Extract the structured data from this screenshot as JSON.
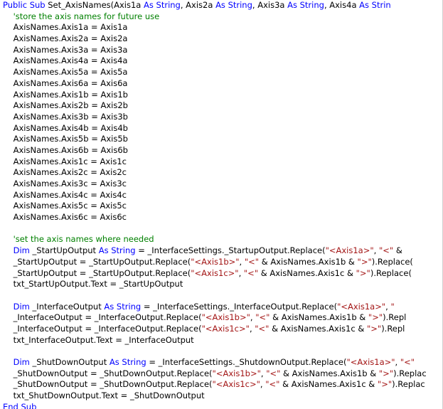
{
  "editor": {
    "colors": {
      "keyword": "#0000ff",
      "comment": "#008000",
      "string": "#a31515",
      "text": "#000000",
      "background": "#ffffff"
    },
    "lines": [
      {
        "indent": "",
        "tokens": [
          {
            "t": "kw",
            "v": "Public Sub"
          },
          {
            "t": "tx",
            "v": " Set_AxisNames(Axis1a "
          },
          {
            "t": "kw",
            "v": "As"
          },
          {
            "t": "tx",
            "v": " "
          },
          {
            "t": "kw",
            "v": "String"
          },
          {
            "t": "tx",
            "v": ", Axis2a "
          },
          {
            "t": "kw",
            "v": "As"
          },
          {
            "t": "tx",
            "v": " "
          },
          {
            "t": "kw",
            "v": "String"
          },
          {
            "t": "tx",
            "v": ", Axis3a "
          },
          {
            "t": "kw",
            "v": "As"
          },
          {
            "t": "tx",
            "v": " "
          },
          {
            "t": "kw",
            "v": "String"
          },
          {
            "t": "tx",
            "v": ", Axis4a "
          },
          {
            "t": "kw",
            "v": "As"
          },
          {
            "t": "tx",
            "v": " "
          },
          {
            "t": "kw",
            "v": "Strin"
          }
        ]
      },
      {
        "indent": "    ",
        "tokens": [
          {
            "t": "cm",
            "v": "'store the axis names for future use"
          }
        ]
      },
      {
        "indent": "    ",
        "tokens": [
          {
            "t": "tx",
            "v": "AxisNames.Axis1a = Axis1a"
          }
        ]
      },
      {
        "indent": "    ",
        "tokens": [
          {
            "t": "tx",
            "v": "AxisNames.Axis2a = Axis2a"
          }
        ]
      },
      {
        "indent": "    ",
        "tokens": [
          {
            "t": "tx",
            "v": "AxisNames.Axis3a = Axis3a"
          }
        ]
      },
      {
        "indent": "    ",
        "tokens": [
          {
            "t": "tx",
            "v": "AxisNames.Axis4a = Axis4a"
          }
        ]
      },
      {
        "indent": "    ",
        "tokens": [
          {
            "t": "tx",
            "v": "AxisNames.Axis5a = Axis5a"
          }
        ]
      },
      {
        "indent": "    ",
        "tokens": [
          {
            "t": "tx",
            "v": "AxisNames.Axis6a = Axis6a"
          }
        ]
      },
      {
        "indent": "    ",
        "tokens": [
          {
            "t": "tx",
            "v": "AxisNames.Axis1b = Axis1b"
          }
        ]
      },
      {
        "indent": "    ",
        "tokens": [
          {
            "t": "tx",
            "v": "AxisNames.Axis2b = Axis2b"
          }
        ]
      },
      {
        "indent": "    ",
        "tokens": [
          {
            "t": "tx",
            "v": "AxisNames.Axis3b = Axis3b"
          }
        ]
      },
      {
        "indent": "    ",
        "tokens": [
          {
            "t": "tx",
            "v": "AxisNames.Axis4b = Axis4b"
          }
        ]
      },
      {
        "indent": "    ",
        "tokens": [
          {
            "t": "tx",
            "v": "AxisNames.Axis5b = Axis5b"
          }
        ]
      },
      {
        "indent": "    ",
        "tokens": [
          {
            "t": "tx",
            "v": "AxisNames.Axis6b = Axis6b"
          }
        ]
      },
      {
        "indent": "    ",
        "tokens": [
          {
            "t": "tx",
            "v": "AxisNames.Axis1c = Axis1c"
          }
        ]
      },
      {
        "indent": "    ",
        "tokens": [
          {
            "t": "tx",
            "v": "AxisNames.Axis2c = Axis2c"
          }
        ]
      },
      {
        "indent": "    ",
        "tokens": [
          {
            "t": "tx",
            "v": "AxisNames.Axis3c = Axis3c"
          }
        ]
      },
      {
        "indent": "    ",
        "tokens": [
          {
            "t": "tx",
            "v": "AxisNames.Axis4c = Axis4c"
          }
        ]
      },
      {
        "indent": "    ",
        "tokens": [
          {
            "t": "tx",
            "v": "AxisNames.Axis5c = Axis5c"
          }
        ]
      },
      {
        "indent": "    ",
        "tokens": [
          {
            "t": "tx",
            "v": "AxisNames.Axis6c = Axis6c"
          }
        ]
      },
      {
        "indent": "",
        "tokens": []
      },
      {
        "indent": "    ",
        "tokens": [
          {
            "t": "cm",
            "v": "'set the axis names where needed"
          }
        ]
      },
      {
        "indent": "    ",
        "tokens": [
          {
            "t": "kw",
            "v": "Dim"
          },
          {
            "t": "tx",
            "v": " _StartUpOutput "
          },
          {
            "t": "kw",
            "v": "As"
          },
          {
            "t": "tx",
            "v": " "
          },
          {
            "t": "kw",
            "v": "String"
          },
          {
            "t": "tx",
            "v": " = _InterfaceSettings._StartupOutput.Replace("
          },
          {
            "t": "st",
            "v": "\"<Axis1a>\""
          },
          {
            "t": "tx",
            "v": ", "
          },
          {
            "t": "st",
            "v": "\"<\""
          },
          {
            "t": "tx",
            "v": " &"
          }
        ]
      },
      {
        "indent": "    ",
        "tokens": [
          {
            "t": "tx",
            "v": "_StartUpOutput = _StartUpOutput.Replace("
          },
          {
            "t": "st",
            "v": "\"<Axis1b>\""
          },
          {
            "t": "tx",
            "v": ", "
          },
          {
            "t": "st",
            "v": "\"<\""
          },
          {
            "t": "tx",
            "v": " & AxisNames.Axis1b & "
          },
          {
            "t": "st",
            "v": "\">\""
          },
          {
            "t": "tx",
            "v": ").Replace("
          }
        ]
      },
      {
        "indent": "    ",
        "tokens": [
          {
            "t": "tx",
            "v": "_StartUpOutput = _StartUpOutput.Replace("
          },
          {
            "t": "st",
            "v": "\"<Axis1c>\""
          },
          {
            "t": "tx",
            "v": ", "
          },
          {
            "t": "st",
            "v": "\"<\""
          },
          {
            "t": "tx",
            "v": " & AxisNames.Axis1c & "
          },
          {
            "t": "st",
            "v": "\">\""
          },
          {
            "t": "tx",
            "v": ").Replace("
          }
        ]
      },
      {
        "indent": "    ",
        "tokens": [
          {
            "t": "tx",
            "v": "txt_StartUpOutput.Text = _StartUpOutput"
          }
        ]
      },
      {
        "indent": "",
        "tokens": []
      },
      {
        "indent": "    ",
        "tokens": [
          {
            "t": "kw",
            "v": "Dim"
          },
          {
            "t": "tx",
            "v": " _InterfaceOutput "
          },
          {
            "t": "kw",
            "v": "As"
          },
          {
            "t": "tx",
            "v": " "
          },
          {
            "t": "kw",
            "v": "String"
          },
          {
            "t": "tx",
            "v": " = _InterfaceSettings._InterfaceOutput.Replace("
          },
          {
            "t": "st",
            "v": "\"<Axis1a>\""
          },
          {
            "t": "tx",
            "v": ", "
          },
          {
            "t": "st",
            "v": "\""
          }
        ]
      },
      {
        "indent": "    ",
        "tokens": [
          {
            "t": "tx",
            "v": "_InterfaceOutput = _InterfaceOutput.Replace("
          },
          {
            "t": "st",
            "v": "\"<Axis1b>\""
          },
          {
            "t": "tx",
            "v": ", "
          },
          {
            "t": "st",
            "v": "\"<\""
          },
          {
            "t": "tx",
            "v": " & AxisNames.Axis1b & "
          },
          {
            "t": "st",
            "v": "\">\""
          },
          {
            "t": "tx",
            "v": ").Repl"
          }
        ]
      },
      {
        "indent": "    ",
        "tokens": [
          {
            "t": "tx",
            "v": "_InterfaceOutput = _InterfaceOutput.Replace("
          },
          {
            "t": "st",
            "v": "\"<Axis1c>\""
          },
          {
            "t": "tx",
            "v": ", "
          },
          {
            "t": "st",
            "v": "\"<\""
          },
          {
            "t": "tx",
            "v": " & AxisNames.Axis1c & "
          },
          {
            "t": "st",
            "v": "\">\""
          },
          {
            "t": "tx",
            "v": ").Repl"
          }
        ]
      },
      {
        "indent": "    ",
        "tokens": [
          {
            "t": "tx",
            "v": "txt_InterfaceOutput.Text = _InterfaceOutput"
          }
        ]
      },
      {
        "indent": "",
        "tokens": []
      },
      {
        "indent": "    ",
        "tokens": [
          {
            "t": "kw",
            "v": "Dim"
          },
          {
            "t": "tx",
            "v": " _ShutDownOutput "
          },
          {
            "t": "kw",
            "v": "As"
          },
          {
            "t": "tx",
            "v": " "
          },
          {
            "t": "kw",
            "v": "String"
          },
          {
            "t": "tx",
            "v": " = _InterfaceSettings._ShutdownOutput.Replace("
          },
          {
            "t": "st",
            "v": "\"<Axis1a>\""
          },
          {
            "t": "tx",
            "v": ", "
          },
          {
            "t": "st",
            "v": "\"<\""
          }
        ]
      },
      {
        "indent": "    ",
        "tokens": [
          {
            "t": "tx",
            "v": "_ShutDownOutput = _ShutDownOutput.Replace("
          },
          {
            "t": "st",
            "v": "\"<Axis1b>\""
          },
          {
            "t": "tx",
            "v": ", "
          },
          {
            "t": "st",
            "v": "\"<\""
          },
          {
            "t": "tx",
            "v": " & AxisNames.Axis1b & "
          },
          {
            "t": "st",
            "v": "\">\""
          },
          {
            "t": "tx",
            "v": ").Replac"
          }
        ]
      },
      {
        "indent": "    ",
        "tokens": [
          {
            "t": "tx",
            "v": "_ShutDownOutput = _ShutDownOutput.Replace("
          },
          {
            "t": "st",
            "v": "\"<Axis1c>\""
          },
          {
            "t": "tx",
            "v": ", "
          },
          {
            "t": "st",
            "v": "\"<\""
          },
          {
            "t": "tx",
            "v": " & AxisNames.Axis1c & "
          },
          {
            "t": "st",
            "v": "\">\""
          },
          {
            "t": "tx",
            "v": ").Replac"
          }
        ]
      },
      {
        "indent": "    ",
        "tokens": [
          {
            "t": "tx",
            "v": "txt_ShutDownOutput.Text = _ShutDownOutput"
          }
        ]
      },
      {
        "indent": "",
        "tokens": [
          {
            "t": "kw",
            "v": "End Sub"
          }
        ]
      }
    ]
  }
}
